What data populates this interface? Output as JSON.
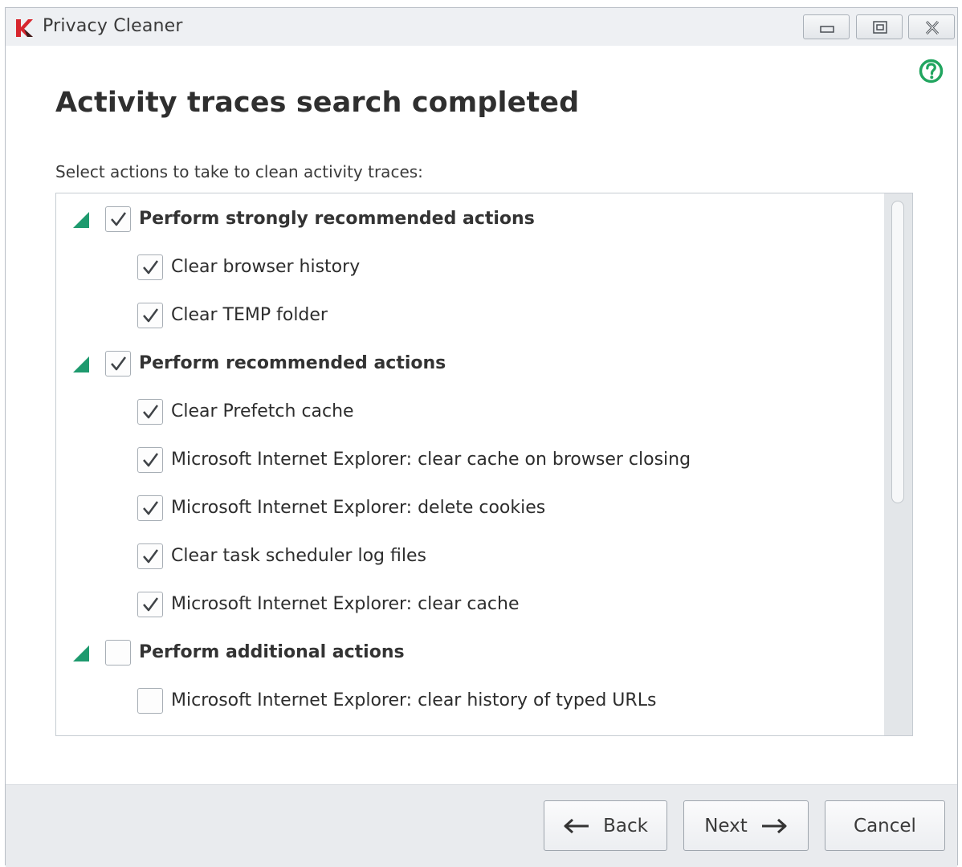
{
  "window": {
    "title": "Privacy Cleaner",
    "icons": {
      "logo": "kaspersky-logo-icon",
      "minimize": "minimize-icon",
      "maximize": "maximize-icon",
      "close": "close-icon",
      "help": "help-icon"
    }
  },
  "main": {
    "title": "Activity traces search completed",
    "subtitle": "Select actions to take to clean activity traces:"
  },
  "actions": [
    {
      "type": "group",
      "label": "Perform strongly recommended actions",
      "checked": true
    },
    {
      "type": "item",
      "label": "Clear browser history",
      "checked": true
    },
    {
      "type": "item",
      "label": "Clear TEMP folder",
      "checked": true
    },
    {
      "type": "group",
      "label": "Perform recommended actions",
      "checked": true
    },
    {
      "type": "item",
      "label": "Clear Prefetch cache",
      "checked": true
    },
    {
      "type": "item",
      "label": "Microsoft Internet Explorer: clear cache on browser closing",
      "checked": true
    },
    {
      "type": "item",
      "label": "Microsoft Internet Explorer: delete cookies",
      "checked": true
    },
    {
      "type": "item",
      "label": "Clear task scheduler log files",
      "checked": true
    },
    {
      "type": "item",
      "label": "Microsoft Internet Explorer: clear cache",
      "checked": true
    },
    {
      "type": "group",
      "label": "Perform additional actions",
      "checked": false
    },
    {
      "type": "item",
      "label": "Microsoft Internet Explorer: clear history of typed URLs",
      "checked": false
    }
  ],
  "footer": {
    "back_label": "Back",
    "next_label": "Next",
    "cancel_label": "Cancel"
  },
  "colors": {
    "accent_green": "#1e9a6e",
    "help_green": "#21a55f",
    "logo_red": "#d7262e"
  }
}
